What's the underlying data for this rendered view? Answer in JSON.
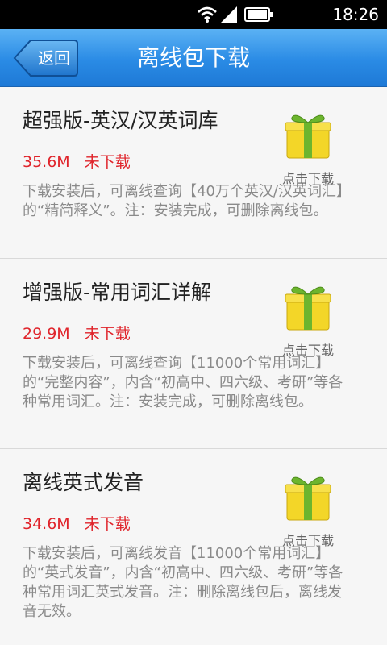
{
  "status_bar": {
    "time": "18:26",
    "icons": [
      "wifi-icon",
      "signal-icon",
      "battery-icon"
    ]
  },
  "header": {
    "back_label": "返回",
    "title": "离线包下载",
    "color": "#2a8be5"
  },
  "packages": [
    {
      "title": "超强版-英汉/汉英词库",
      "size": "35.6M",
      "status": "未下载",
      "desc": "下载安装后，可离线查询【40万个英汉/汉英词汇】的“精简释义”。注：安装完成，可删除离线包。",
      "action": "点击下载"
    },
    {
      "title": "增强版-常用词汇详解",
      "size": "29.9M",
      "status": "未下载",
      "desc": "下载安装后，可离线查询【11000个常用词汇】的“完整内容”，内含“初高中、四六级、考研”等各种常用词汇。注：安装完成，可删除离线包。",
      "action": "点击下载"
    },
    {
      "title": "离线英式发音",
      "size": "34.6M",
      "status": "未下载",
      "desc": "下载安装后，可离线发音【11000个常用词汇】的“英式发音”，内含“初高中、四六级、考研”等各种常用词汇英式发音。注：删除离线包后，离线发音无效。",
      "action": "点击下载"
    }
  ],
  "colors": {
    "accent_red": "#e0242b",
    "gift_yellow": "#f3d628",
    "gift_green": "#6cb52e"
  }
}
